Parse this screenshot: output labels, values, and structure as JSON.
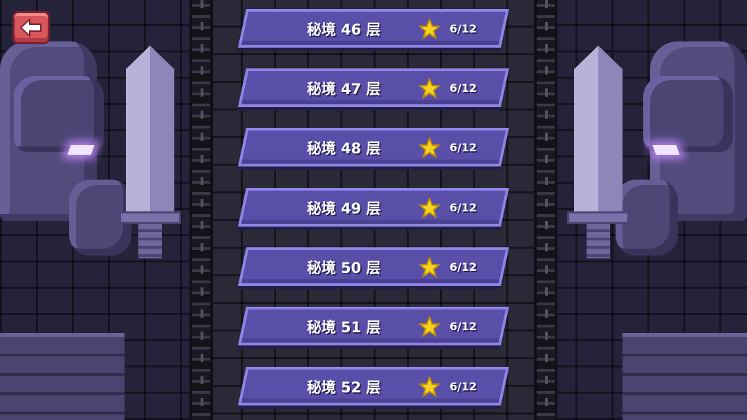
{
  "levels": [
    {
      "name": "秘境 46 层",
      "progress": "6/12"
    },
    {
      "name": "秘境 47 层",
      "progress": "6/12"
    },
    {
      "name": "秘境 48 层",
      "progress": "6/12"
    },
    {
      "name": "秘境 49 层",
      "progress": "6/12"
    },
    {
      "name": "秘境 50 层",
      "progress": "6/12"
    },
    {
      "name": "秘境 51 层",
      "progress": "6/12"
    },
    {
      "name": "秘境 52 层",
      "progress": "6/12"
    }
  ],
  "icons": {
    "back": "arrow-left-icon",
    "star": "star-icon"
  },
  "colors": {
    "row_fill": "#5a4fa8",
    "row_border": "#8f84e6",
    "star": "#f7d21e",
    "back_button": "#d9575a"
  }
}
